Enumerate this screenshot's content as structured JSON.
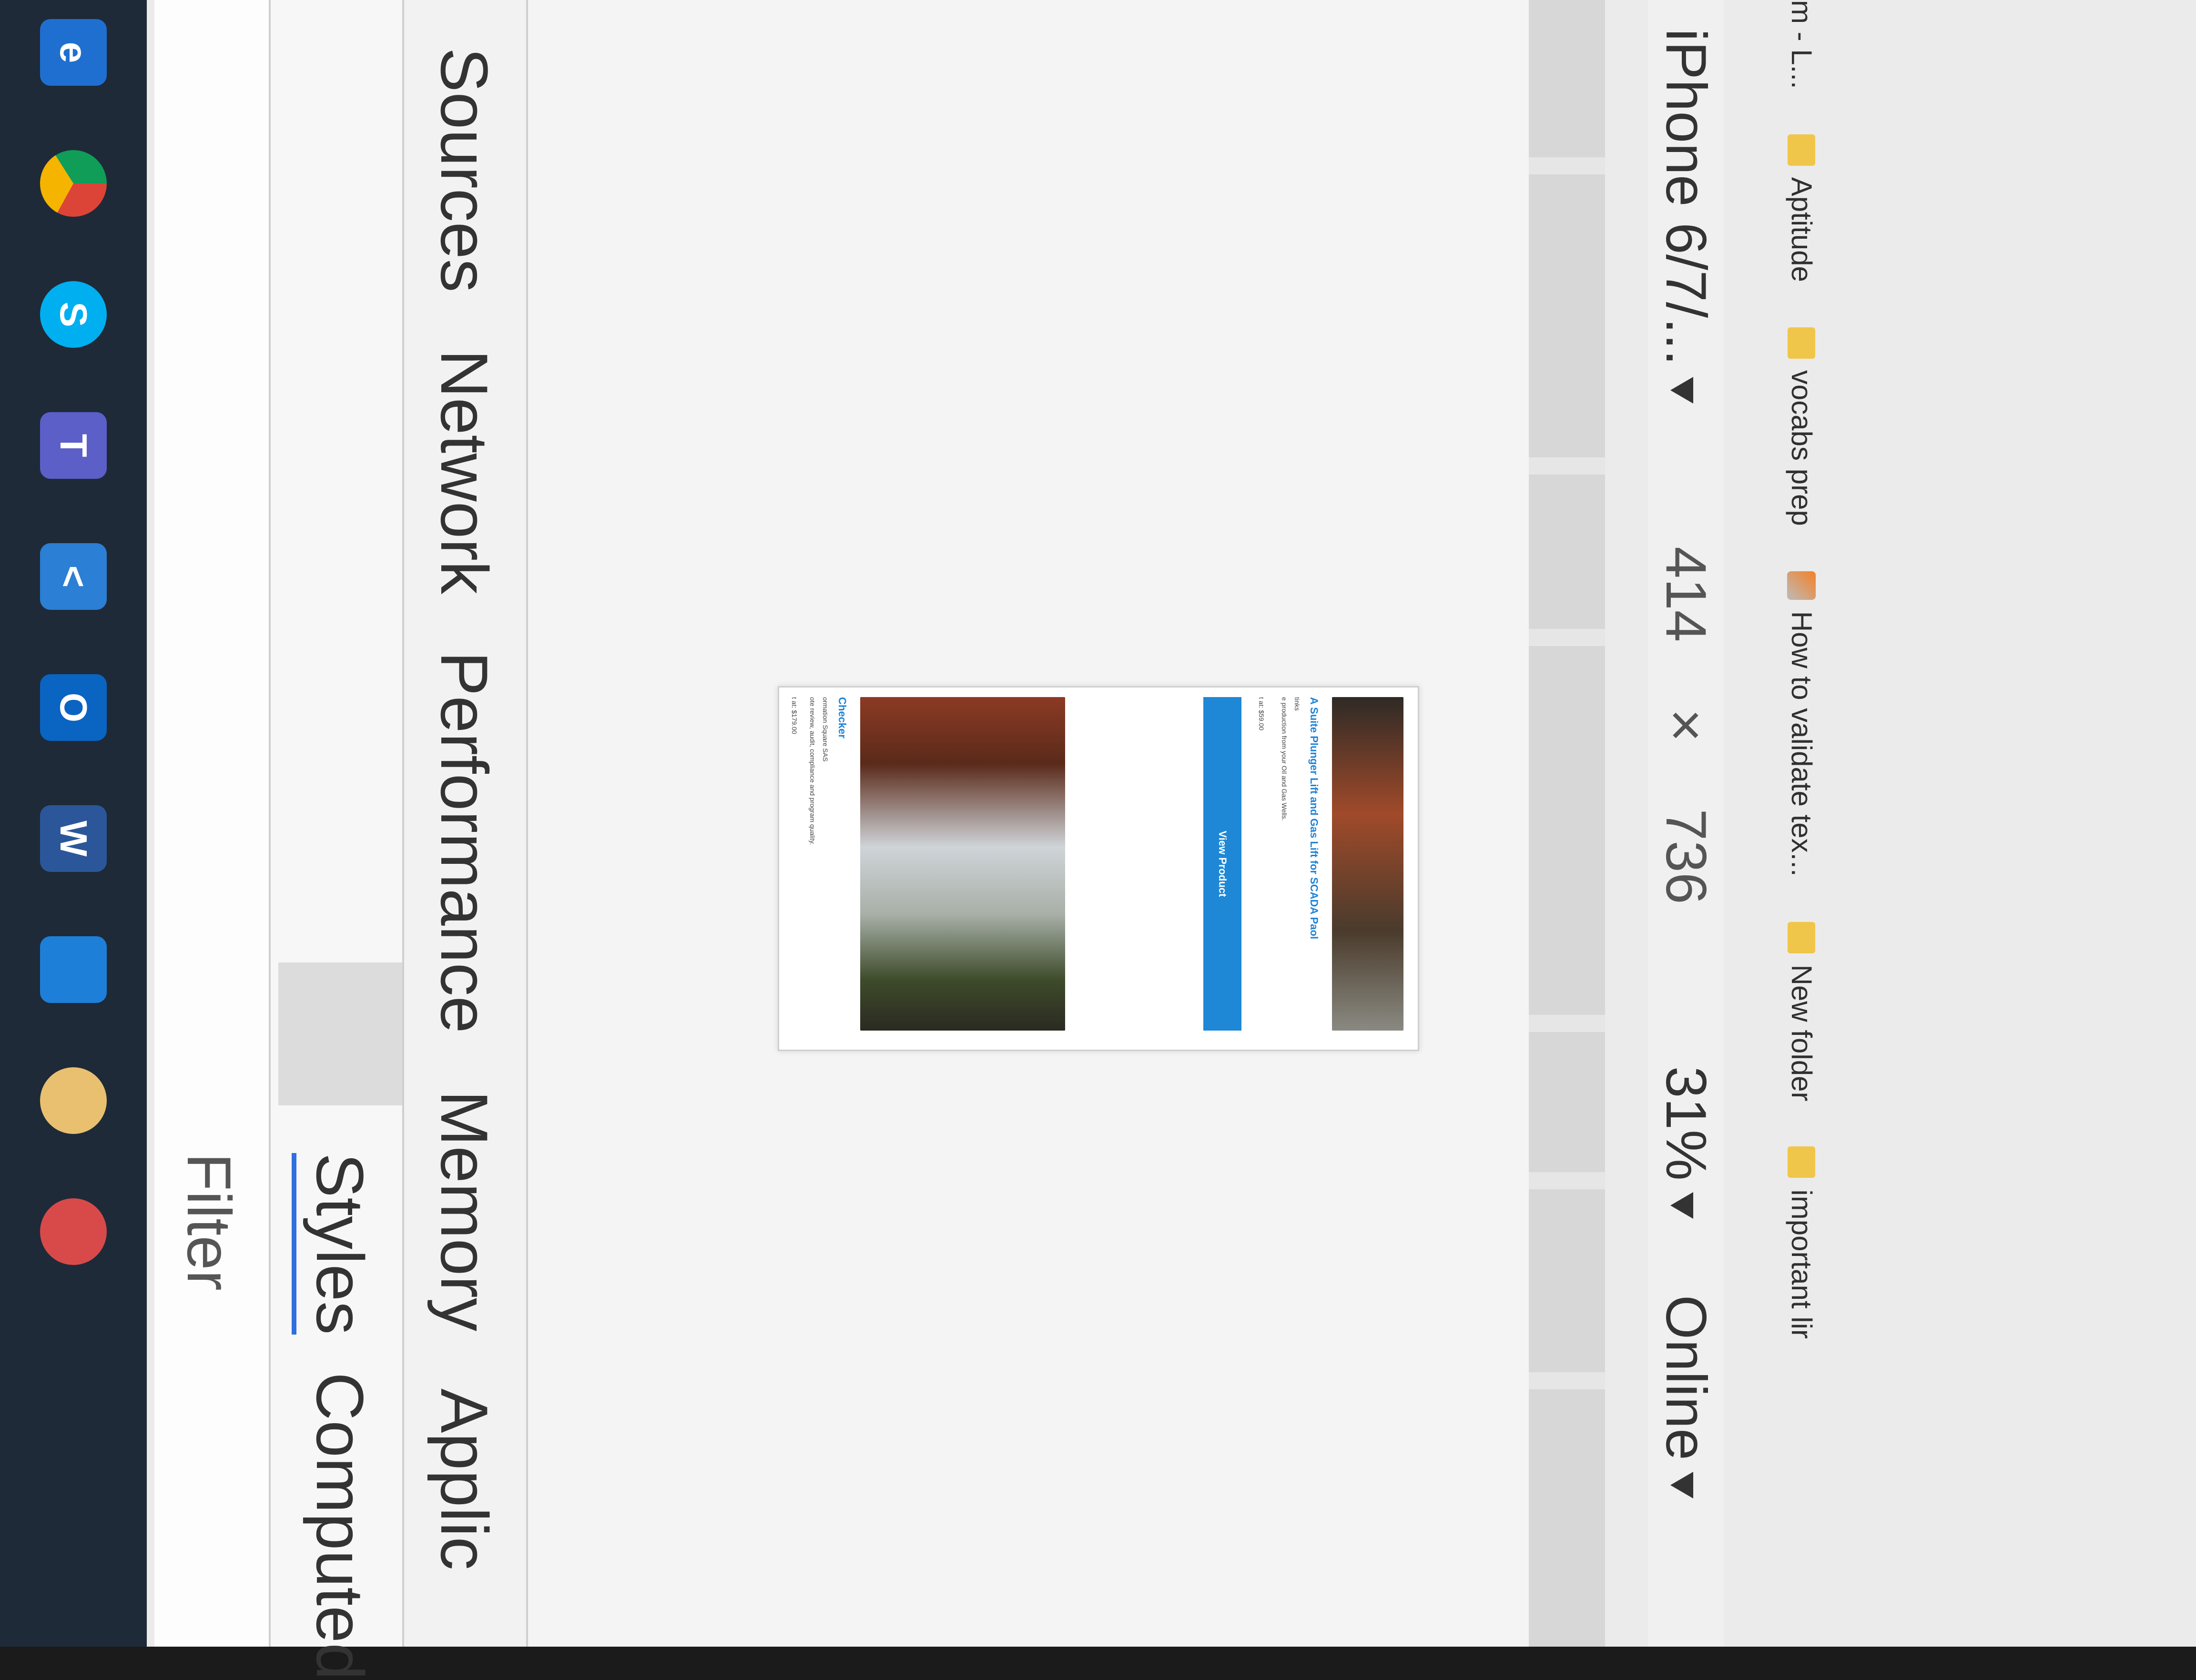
{
  "bookmarks": [
    {
      "label": "m - L...",
      "icon": "none"
    },
    {
      "label": "Aptitude",
      "icon": "folder-icon"
    },
    {
      "label": "vocabs prep",
      "icon": "folder-icon"
    },
    {
      "label": "How to validate tex...",
      "icon": "stackoverflow-icon"
    },
    {
      "label": "New folder",
      "icon": "folder-icon"
    },
    {
      "label": "important lir",
      "icon": "folder-icon"
    }
  ],
  "device_toolbar": {
    "device": "iPhone 6/7/...",
    "width": "414",
    "times": "×",
    "height": "736",
    "zoom": "31%",
    "network": "Online"
  },
  "preview": {
    "card1_title": "A Suite Plunger Lift and Gas Lift for SCADA Paol",
    "card1_line1": "tinks",
    "card1_line2": "e production from your Oil and Gas Wells.",
    "card1_price": "t at: $59.00",
    "card1_button": "View Product",
    "card2_title": "Checker",
    "card2_line1": "ormation Square SAS",
    "card2_line2": "ote review, audit, compliance and program quality.",
    "card2_price": "t at: $179.00"
  },
  "devtools_tabs": [
    "Sources",
    "Network",
    "Performance",
    "Memory",
    "Applic"
  ],
  "styles_tabs": {
    "styles": "Styles",
    "computed": "Computed"
  },
  "filter": {
    "placeholder": "Filter"
  },
  "taskbar_icons": [
    "edge-icon",
    "chrome-icon",
    "skype-icon",
    "teams-icon",
    "vscode-icon",
    "outlook-icon",
    "word-icon",
    "photos-icon",
    "paint-icon",
    "snipping-icon"
  ],
  "colors": {
    "accent": "#1e88d6",
    "tab_underline": "#2f6fe0"
  }
}
